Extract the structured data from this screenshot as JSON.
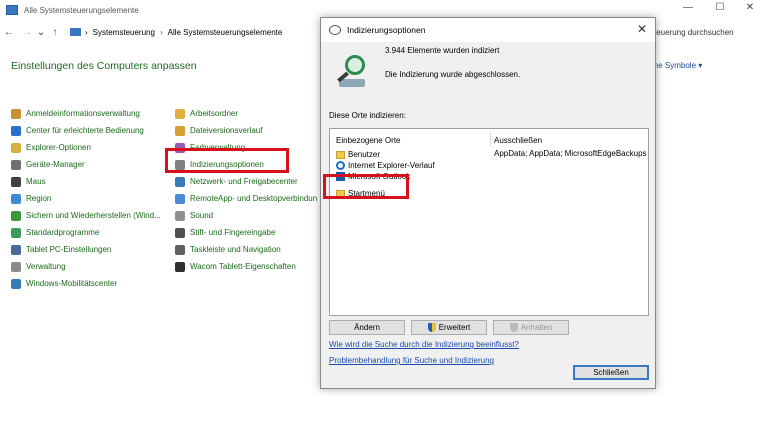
{
  "window": {
    "title": "Alle Systemsteuerungselemente",
    "minimize": "—",
    "maximize": "☐",
    "close": "✕"
  },
  "nav": {
    "back": "←",
    "forward": "→",
    "recent": "⌄",
    "up": "↑",
    "breadcrumb_root": "Systemsteuerung",
    "breadcrumb_current": "Alle Systemsteuerungselemente",
    "separator": "›",
    "search_placeholder": "teuerung durchsuchen"
  },
  "page": {
    "heading": "Einstellungen des Computers anpassen",
    "view_by": "ine Symbole ▾"
  },
  "items_col1": [
    {
      "label": "Anmeldeinformationsverwaltung",
      "color": "#c89030"
    },
    {
      "label": "Center für erleichterte Bedienung",
      "color": "#2a70c8"
    },
    {
      "label": "Explorer-Optionen",
      "color": "#d8b040"
    },
    {
      "label": "Geräte-Manager",
      "color": "#707070"
    },
    {
      "label": "Maus",
      "color": "#404040"
    },
    {
      "label": "Region",
      "color": "#3a8ad8"
    },
    {
      "label": "Sichern und Wiederherstellen (Wind...",
      "color": "#3a9a3a"
    },
    {
      "label": "Standardprogramme",
      "color": "#3a9a5a"
    },
    {
      "label": "Tablet PC-Einstellungen",
      "color": "#4a6a9a"
    },
    {
      "label": "Verwaltung",
      "color": "#8a8a8a"
    },
    {
      "label": "Windows-Mobilitätscenter",
      "color": "#3a7ab8"
    }
  ],
  "items_col2": [
    {
      "label": "Arbeitsordner",
      "color": "#e0b040"
    },
    {
      "label": "Dateiversionsverlauf",
      "color": "#d8a030"
    },
    {
      "label": "Farbverwaltung",
      "color": "#9a5ab8"
    },
    {
      "label": "Indizierungsoptionen",
      "color": "#808080"
    },
    {
      "label": "Netzwerk- und Freigabecenter",
      "color": "#3a7ab8"
    },
    {
      "label": "RemoteApp- und Desktopverbindun",
      "color": "#4a8ad8"
    },
    {
      "label": "Sound",
      "color": "#909090"
    },
    {
      "label": "Stift- und Fingereingabe",
      "color": "#505050"
    },
    {
      "label": "Taskleiste und Navigation",
      "color": "#606060"
    },
    {
      "label": "Wacom Tablett-Eigenschaften",
      "color": "#303030"
    }
  ],
  "dialog": {
    "title": "Indizierungsoptionen",
    "close": "✕",
    "count": "3.944 Elemente wurden indiziert",
    "status": "Die Indizierung wurde abgeschlossen.",
    "places_label": "Diese Orte indizieren:",
    "col_included": "Einbezogene Orte",
    "col_excluded": "Ausschließen",
    "locations": [
      "Benutzer",
      "Internet Explorer-Verlauf",
      "Microsoft Outlook",
      "Startmenü"
    ],
    "exclusions": "AppData; AppData; MicrosoftEdgeBackups",
    "btn_change": "Ändern",
    "btn_advanced": "Erweitert",
    "btn_pause": "Anhalten",
    "link_help": "Wie wird die Suche durch die Indizierung beeinflusst?",
    "link_troubleshoot": "Problembehandlung für Suche und Indizierung",
    "btn_close": "Schließen"
  },
  "colors": {
    "link_green": "#1a6a1a",
    "highlight_red": "#d8101c",
    "link_blue": "#1a4aaa"
  }
}
